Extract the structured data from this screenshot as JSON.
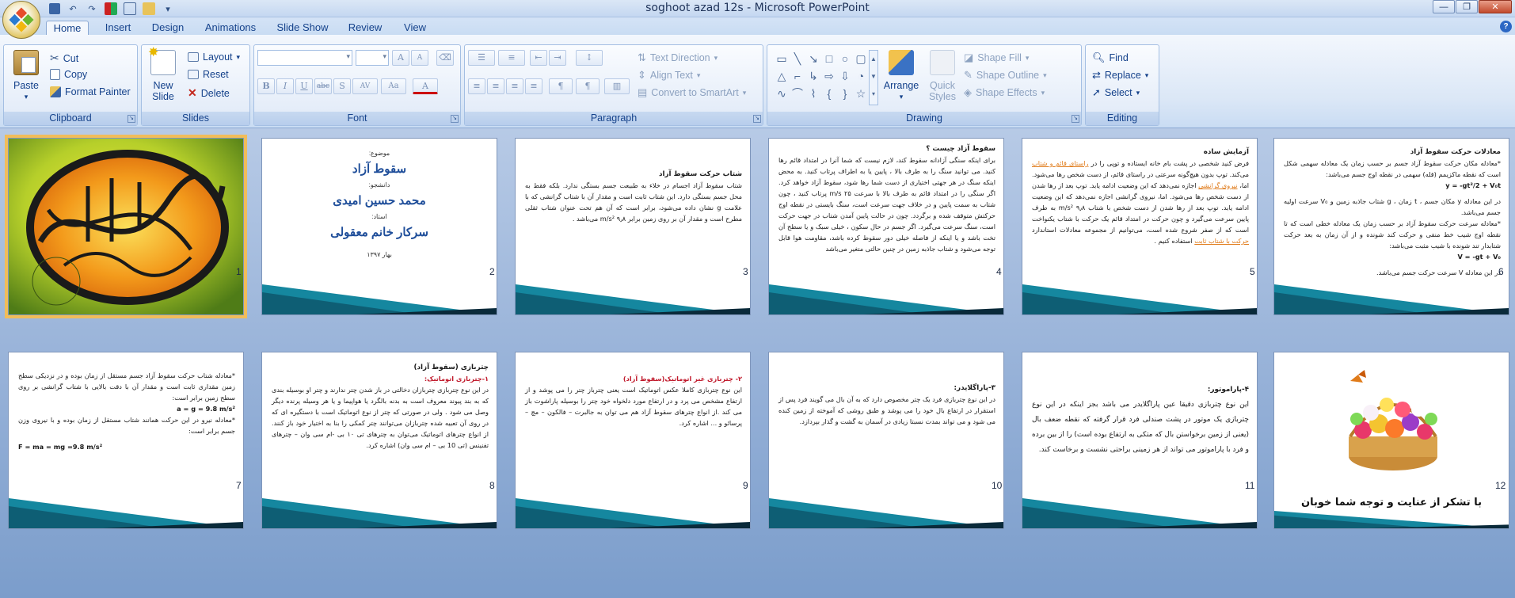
{
  "window": {
    "title": "soghoot azad 12s - Microsoft PowerPoint",
    "controls": [
      "minimize",
      "maximize",
      "close"
    ]
  },
  "tabs": [
    "Home",
    "Insert",
    "Design",
    "Animations",
    "Slide Show",
    "Review",
    "View"
  ],
  "active_tab": "Home",
  "ribbon": {
    "clipboard": {
      "label": "Clipboard",
      "paste": "Paste",
      "cut": "Cut",
      "copy": "Copy",
      "format_painter": "Format Painter"
    },
    "slides": {
      "label": "Slides",
      "new_slide": "New Slide",
      "layout": "Layout",
      "reset": "Reset",
      "delete": "Delete"
    },
    "font": {
      "label": "Font",
      "bold": "B",
      "italic": "I",
      "underline": "U",
      "strike": "abc",
      "shadow": "S",
      "spacing": "AV",
      "case": "Aa",
      "color": "A",
      "grow": "A",
      "shrink": "A"
    },
    "paragraph": {
      "label": "Paragraph",
      "text_direction": "Text Direction",
      "align_text": "Align Text",
      "convert_smartart": "Convert to SmartArt"
    },
    "drawing": {
      "label": "Drawing",
      "arrange": "Arrange",
      "quick_styles": "Quick Styles",
      "shape_fill": "Shape Fill",
      "shape_outline": "Shape Outline",
      "shape_effects": "Shape Effects"
    },
    "editing": {
      "label": "Editing",
      "find": "Find",
      "replace": "Replace",
      "select": "Select"
    }
  },
  "slides": [
    {
      "num": "1"
    },
    {
      "num": "2",
      "l1": "موضوع:",
      "l2": "سقوط آزاد",
      "l3": "دانشجو:",
      "l4": "محمد حسین امیدی",
      "l5": "استاد:",
      "l6": "سرکار خانم معقولی",
      "l7": "بهار ۱۳۹۷"
    },
    {
      "num": "3",
      "title": "شتاب حرکت سقوط آزاد",
      "body": "شتاب سقوط آزاد اجسام در خلاء به طبیعت جسم بستگی ندارد. بلکه فقط به محل جسم بستگی دارد. این شتاب ثابت است و مقدار آن با شتاب گرانشی که با علامت g نشان داده می‌شود، برابر است که آن هم تحت عنوان شتاب ثقلی مطرح است و مقدار آن بر روی زمین برابر ۹٫۸ m/s² می‌باشد ."
    },
    {
      "num": "4",
      "title": "سقوط آزاد چیست ؟",
      "body": "برای اینکه سنگی آزادانه سقوط کند، لازم نیست که شما آنرا در امتداد قائم رها کنید. می توانید سنگ را به طرف بالا ، پایین یا به اطراف پرتاب کنید. به محض اینکه سنگ در هر جهتی اختیاری از دست شما رها شود، سقوط آزاد خواهد کرد. اگر سنگی را در امتداد قائم به طرف بالا با سرعت ۲۵ m/s پرتاب کنید ، چون شتاب به سمت پایین و در خلاف جهت سرعت است، سنگ بایستی در نقطه اوج حرکتش متوقف شده و برگردد. چون در حالت پایین آمدن شتاب در جهت حرکت است، سنگ سرعت می‌گیرد. اگر جسم در حال سکون ، خیلی سبک و یا سطح آن تخت باشد و یا اینکه از فاصله خیلی دور سقوط کرده باشد، مقاومت هوا قابل توجه می‌شود و شتاب جاذبه زمین در چنین حالتی متغیر می‌باشد"
    },
    {
      "num": "5",
      "title": "آزمایش ساده",
      "body_a": "فرض کنید شخصی در پشت بام خانه ایستاده و توپی را در",
      "link1": "راستای قائم و شتاب",
      "body_b": "می‌کند. توپ بدون هیچ‌گونه سرعتی در راستای قائم، از دست شخص رها می‌شود. اما،",
      "link2": "نیروی گرانشی",
      "body_c": "اجازه نمی‌دهد که این وضعیت ادامه یابد. توپ بعد از رها شدن از دست شخص رها می‌شود. اما، نیروی گرانشی اجازه نمی‌دهد که این وضعیت ادامه یابد. توپ بعد از رها شدن از دست شخص با شتاب ۹٫۸ m/s² به طرف پایین سرعت می‌گیرد و چون حرکت در امتداد قائم یک حرکت با شتاب یکنواخت است که از صفر شروع شده است، می‌توانیم از مجموعه معادلات استاندارد",
      "link3": "حرکت با شتاب ثابت",
      "body_d": "استفاده کنیم ."
    },
    {
      "num": "6",
      "title": "معادلات حرکت سقوط آزاد",
      "body_a": "*معادله مکان حرکت سقوط آزاد جسم بر حسب زمان یک معادله سهمی شکل است که نقطه ماکزیمم (قله) سهمی در نقطه اوج جسم می‌باشد:",
      "eq1": "y = -gt²/2 + V₀t",
      "body_b": "در این معادله y مکان جسم ، t زمان ، g شتاب جاذبه زمین و V₀ سرعت اولیه جسم می‌باشد.",
      "body_c": "*معادله سرعت حرکت سقوط آزاد بر حسب زمان یک معادله خطی است که تا نقطه اوج شیب خط منفی و حرکت کند شونده و از آن زمان به بعد حرکت شتابدار تند شونده با شیب مثبت می‌باشد:",
      "eq2": "V = -gt + V₀",
      "body_d": "در این معادله V سرعت حرکت جسم می‌باشد."
    },
    {
      "num": "7",
      "body_a": "*معادله شتاب حرکت سقوط آزاد جسم مستقل از زمان بوده و در نزدیکی سطح زمین مقداری ثابت است و مقدار آن با دقت بالایی با شتاب گرانشی بر روی سطح زمین برابر است:",
      "eq1": "a = g = 9.8 m/s²",
      "body_b": "*معادله نیرو در این حرکت همانند شتاب مستقل از زمان بوده و با نیروی وزن جسم برابر است:",
      "eq2": "F = ma = mg =9.8 m/s²"
    },
    {
      "num": "8",
      "title": "چتربازی (سقوط آزاد)",
      "sub": "۱-چتربازی اتوماتیک:",
      "body": "در این نوع چتربازی چتربازان دخالتی در باز شدن چتر ندارند و چتر او بوسیله بندی که به بند پیوند معروف است به بدنه بالگرد یا هواپیما و یا هر وسیله پرنده دیگر وصل می شود . ولی در صورتی که چتر از نوع اتوماتیک است با دستگیره ای که در روی آن تعبیه شده چتربازان می‌توانند چتر کمکی را بنا به اختیار خود باز کنند. از انواع چترهای اتوماتیک می‌توان به چترهای تی ۱۰ بی -ام سی وان – چترهای تفنینس (تی 10 بی – ام سی وان) اشاره کرد."
    },
    {
      "num": "9",
      "sub": "۲- چتربازی غیر اتوماتیک(سقوط آزاد)",
      "body": "این نوع چتربازی کاملا عکس اتوماتیک است یعنی چترباز چتر را می پوشد و از ارتفاع مشخص می پرد و در ارتفاع مورد دلخواه خود چتر را بوسیله پاراشوت باز می کند .از انواع چترهای سقوط آزاد هم می توان به جالبرت – فالکون – مچ – پرسائو و ... اشاره کرد."
    },
    {
      "num": "10",
      "title": "۳-پاراگلایدر:",
      "body": "در این نوع چتربازی فرد یک چتر مخصوص دارد که به آن بال می گویند فرد پس از استقرار در ارتفاع بال خود را می پوشد و طبق روشی که آموخته از زمین کنده می شود و می تواند بمدت نسبتا زیادی در آسمان به گشت و گذار بپردازد."
    },
    {
      "num": "11",
      "title": "۴-پاراموتور:",
      "body": "این نوع چتربازی دقیقا عین پاراگلایدر می باشد بجز اینکه در این نوع چتربازی یک موتور در پشت صندلی فرد قرار گرفته که نقطه ضعف بال (یعنی از زمین برخواستن بال که متکی به ارتفاع بوده است) را از بین برده و فرد با پاراموتور می تواند از هر زمینی براحتی نشست و برخاست کند."
    },
    {
      "num": "12",
      "thanks": "با تشکر از عنایت و توجه شما خوبان"
    }
  ],
  "colors": {
    "accent": "#2c5fa8",
    "selection": "#f1bd5a",
    "slide_footer": "#1a8ab0"
  }
}
